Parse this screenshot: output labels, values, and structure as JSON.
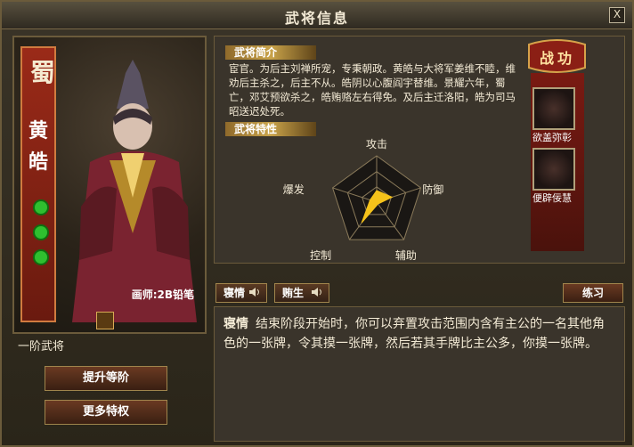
{
  "window": {
    "title": "武将信息",
    "close_label": "X"
  },
  "hero": {
    "kingdom": "蜀",
    "name_chars": [
      "黄",
      "皓"
    ],
    "artist": "画师:2B铅笔",
    "rank": "一阶武将",
    "upgrade_label": "提升等阶",
    "privileges_label": "更多特权",
    "stars": 3
  },
  "intro": {
    "label": "武将简介",
    "text": "宦官。为后主刘禅所宠，专秉朝政。黄皓与大将军姜维不睦，维劝后主杀之，后主不从。皓阴以心腹阎宇替维。景耀六年，蜀亡，邓艾预欲杀之，皓贿赂左右得免。及后主迁洛阳，皓为司马昭送迟处死。"
  },
  "features": {
    "label": "武将特性",
    "axes": [
      "攻击",
      "防御",
      "辅助",
      "控制",
      "爆发"
    ],
    "values": [
      0.25,
      0.35,
      0.05,
      0.55,
      0.15
    ]
  },
  "merit": {
    "title": "战功",
    "items": [
      {
        "name": "欲盖弥彰"
      },
      {
        "name": "便辟佞慧"
      }
    ]
  },
  "skills": {
    "items": [
      {
        "label": "寝情"
      },
      {
        "label": "贿生"
      }
    ],
    "practice_label": "练习",
    "detail_title": "寝情",
    "detail_text": "结束阶段开始时，你可以弃置攻击范围内含有主公的一名其他角色的一张牌，令其摸一张牌，然后若其手牌比主公多，你摸一张牌。"
  }
}
